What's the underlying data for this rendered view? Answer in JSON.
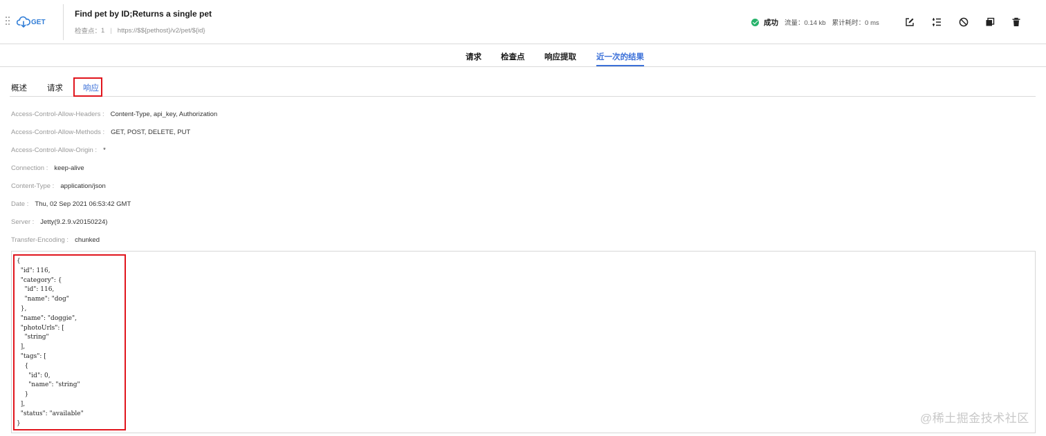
{
  "header": {
    "method": "GET",
    "title": "Find pet by ID;Returns a single pet",
    "checkpoints_label": "检查点：",
    "checkpoints_count": "1",
    "separator": "|",
    "url": "https://$${pethost}/v2/pet/${id}",
    "status": {
      "result": "成功",
      "traffic": "流量：0.14 kb",
      "elapsed": "累计耗时：0 ms"
    },
    "tools": [
      "edit-icon",
      "list-settings-icon",
      "disable-icon",
      "copy-icon",
      "delete-icon"
    ]
  },
  "main_tabs": [
    "请求",
    "检查点",
    "响应提取",
    "近一次的结果"
  ],
  "sub_tabs": [
    "概述",
    "请求",
    "响应"
  ],
  "response_headers": [
    {
      "key": "Access-Control-Allow-Headers :",
      "value": "Content-Type, api_key, Authorization"
    },
    {
      "key": "Access-Control-Allow-Methods :",
      "value": "GET, POST, DELETE, PUT"
    },
    {
      "key": "Access-Control-Allow-Origin :",
      "value": "*"
    },
    {
      "key": "Connection :",
      "value": "keep-alive"
    },
    {
      "key": "Content-Type :",
      "value": "application/json"
    },
    {
      "key": "Date :",
      "value": "Thu, 02 Sep 2021 06:53:42 GMT"
    },
    {
      "key": "Server :",
      "value": "Jetty(9.2.9.v20150224)"
    },
    {
      "key": "Transfer-Encoding :",
      "value": "chunked"
    }
  ],
  "response_body": "{\n  \"id\": 116,\n  \"category\": {\n    \"id\": 116,\n    \"name\": \"dog\"\n  },\n  \"name\": \"doggie\",\n  \"photoUrls\": [\n    \"string\"\n  ],\n  \"tags\": [\n    {\n      \"id\": 0,\n      \"name\": \"string\"\n    }\n  ],\n  \"status\": \"available\"\n}",
  "watermark": "@稀土掘金技术社区",
  "colors": {
    "accent": "#3a6fd8",
    "highlight": "#e0141c",
    "success": "#27b36b"
  }
}
